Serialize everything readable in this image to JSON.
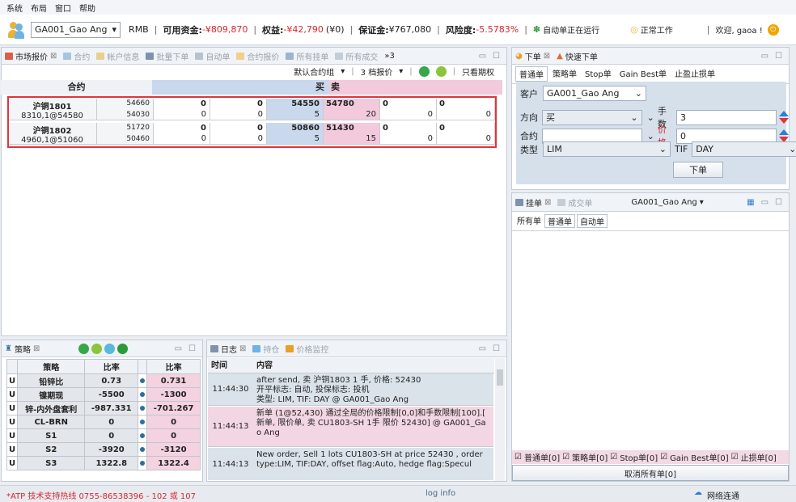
{
  "menu": [
    "系统",
    "布局",
    "窗口",
    "帮助"
  ],
  "account": {
    "name": "GA001_Gao Ang",
    "currency": "RMB",
    "available_label": "可用资金:",
    "available": "-¥809,870",
    "equity_label": "权益:",
    "equity": "-¥42,790",
    "equity_extra": "(¥0)",
    "margin_label": "保证金:",
    "margin": "¥767,080",
    "risk_label": "风险度:",
    "risk": "-5.5783%",
    "auto_running": "自动单正在运行",
    "working": "正常工作",
    "welcome": "欢迎, gaoa !"
  },
  "market_tabs": [
    "市场报价",
    "合约",
    "帐户信息",
    "批量下单",
    "自动单",
    "合约报价",
    "所有挂单",
    "所有成交",
    "»3"
  ],
  "market_toolbar": {
    "group": "默认合约组",
    "depth": "3 档报价",
    "options_only": "只看期权"
  },
  "market_header": {
    "contract": "合约",
    "buy": "买",
    "sell": "卖"
  },
  "market_rows": [
    {
      "name": "沪铜1801",
      "sub": "8310,1@54580",
      "hi": "54660",
      "lo": "54030",
      "c1t": "0",
      "c1b": "0",
      "c2t": "0",
      "c2b": "0",
      "bid": "54550",
      "bidq": "5",
      "ask": "54780",
      "askq": "20",
      "c5t": "0",
      "c5b": "0",
      "c6t": "0",
      "c6b": "0"
    },
    {
      "name": "沪铜1802",
      "sub": "4960,1@51060",
      "hi": "51720",
      "lo": "50460",
      "c1t": "0",
      "c1b": "0",
      "c2t": "0",
      "c2b": "0",
      "bid": "50860",
      "bidq": "5",
      "ask": "51430",
      "askq": "15",
      "c5t": "0",
      "c5b": "0",
      "c6t": "0",
      "c6b": "0"
    }
  ],
  "order_tabs": {
    "order": "下单",
    "quick": "快速下单"
  },
  "order_subtabs": [
    "普通单",
    "策略单",
    "Stop单",
    "Gain Best单",
    "止盈止损单"
  ],
  "order_form": {
    "client_label": "客户",
    "client": "GA001_Gao Ang",
    "direction_label": "方向",
    "direction": "买",
    "qty_label": "手数",
    "qty": "3",
    "contract_label": "合约",
    "contract": "",
    "price_label": "价格",
    "price": "0",
    "type_label": "类型",
    "type": "LIM",
    "tif_label": "TIF",
    "tif": "DAY",
    "submit": "下单"
  },
  "pending_tabs": {
    "pending": "挂单",
    "filled": "成交单",
    "account": "GA001_Gao Ang"
  },
  "pending_subtabs": [
    "所有单",
    "普通单",
    "自动单"
  ],
  "pending_filters": [
    "普通单[0]",
    "策略单[0]",
    "Stop单[0]",
    "Gain Best单[0]",
    "止损单[0]"
  ],
  "cancel_all": "取消所有单[0]",
  "strategy_tab": "策略",
  "strategy_header": {
    "name": "策略",
    "ratio1": "比率",
    "ratio2": "比率"
  },
  "strategies": [
    {
      "flag": "U",
      "name": "铅锌比",
      "r1": "0.73",
      "r2": "0.731"
    },
    {
      "flag": "U",
      "name": "镍期现",
      "r1": "-5500",
      "r2": "-1300"
    },
    {
      "flag": "U",
      "name": "锌-内外盘套利",
      "r1": "-987.331",
      "r2": "-701.267"
    },
    {
      "flag": "U",
      "name": "CL-BRN",
      "r1": "0",
      "r2": "0"
    },
    {
      "flag": "U",
      "name": "S1",
      "r1": "0",
      "r2": "0"
    },
    {
      "flag": "U",
      "name": "S2",
      "r1": "-3920",
      "r2": "-3120"
    },
    {
      "flag": "U",
      "name": "S3",
      "r1": "1322.8",
      "r2": "1322.4"
    }
  ],
  "log_tabs": [
    "日志",
    "持仓",
    "价格监控"
  ],
  "log_header": {
    "time": "时间",
    "content": "内容"
  },
  "logs": [
    {
      "time": "11:44:30",
      "lines": [
        "after send, 卖 沪铜1803 1 手, 价格: 52430",
        "开平标志: 自动, 投保标志: 投机",
        "类型: LIM, TIF: DAY @ GA001_Gao Ang"
      ]
    },
    {
      "time": "11:44:13",
      "lines": [
        "新单 (1@52,430) 通过全局的价格限制[0,0]和手数限制[100].[",
        "新单, 限价单, 卖 CU1803-SH 1手 限价 52430] @ GA001_Ga",
        "o Ang"
      ]
    },
    {
      "time": "11:44:13",
      "lines": [
        "New order, Sell 1 lots CU1803-SH at price 52430 , order",
        " type:LIM, TIF:DAY, offset flag:Auto, hedge flag:Specul"
      ]
    }
  ],
  "status": {
    "hotline": "*ATP 技术支持热线 0755-86538396 - 102 或 107",
    "log": "log info",
    "network": "网络连通"
  },
  "colors": {
    "buy_bg": "#c9d8ec",
    "sell_bg": "#f3c9dc",
    "negative": "#d9262a",
    "highlight": "#e0343a"
  }
}
